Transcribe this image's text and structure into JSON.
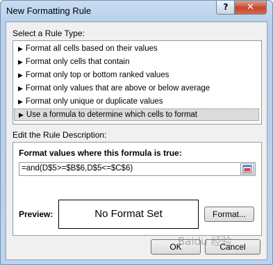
{
  "window": {
    "title": "New Formatting Rule",
    "help_glyph": "?",
    "close_glyph": "✕"
  },
  "rule_type": {
    "label": "Select a Rule Type:",
    "items": [
      {
        "label": "Format all cells based on their values"
      },
      {
        "label": "Format only cells that contain"
      },
      {
        "label": "Format only top or bottom ranked values"
      },
      {
        "label": "Format only values that are above or below average"
      },
      {
        "label": "Format only unique or duplicate values"
      },
      {
        "label": "Use a formula to determine which cells to format"
      }
    ],
    "selected_index": 5
  },
  "description": {
    "label": "Edit the Rule Description:",
    "formula_label": "Format values where this formula is true:",
    "formula_value": "=and(D$5>=$B$6,D$5<=$C$6)",
    "preview_label": "Preview:",
    "preview_text": "No Format Set",
    "format_button": "Format..."
  },
  "buttons": {
    "ok": "OK",
    "cancel": "Cancel"
  },
  "watermark": "Baidu 经验",
  "colors": {
    "title_gradient_top": "#c9dcf2",
    "client_bg": "#f0f0f0",
    "selected_item_bg": "#dcdcdc",
    "close_red": "#c8452a"
  },
  "icons": [
    "arrow-right-icon",
    "collapse-dialog-icon",
    "help-icon",
    "close-icon"
  ]
}
